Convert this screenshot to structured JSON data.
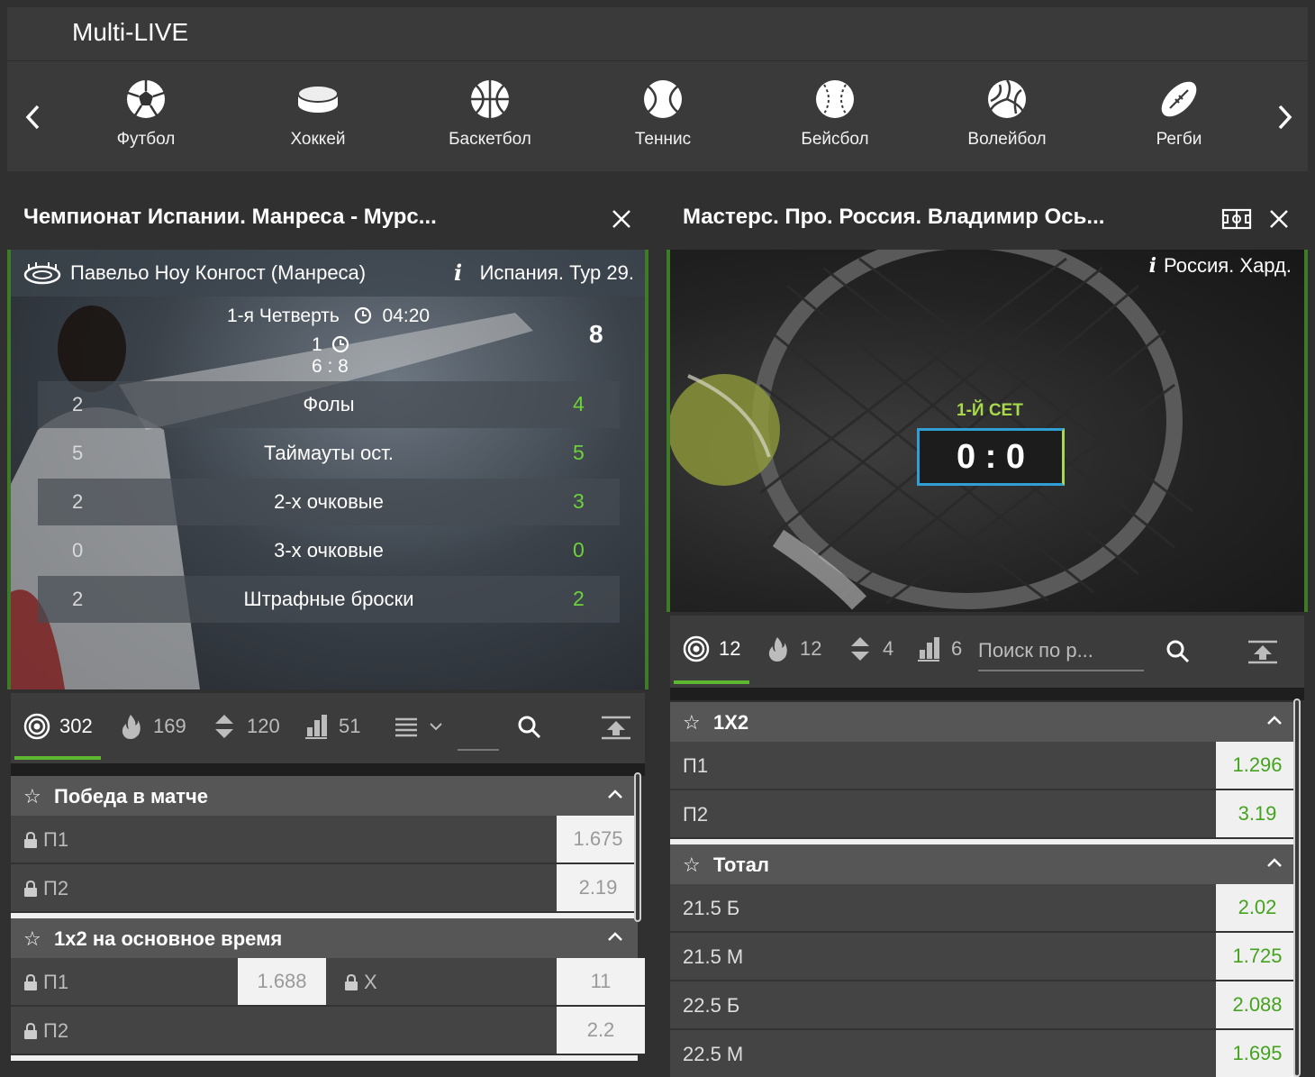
{
  "header": {
    "title": "Multi-LIVE"
  },
  "sports": [
    {
      "label": "Футбол",
      "icon": "soccer-ball-icon"
    },
    {
      "label": "Хоккей",
      "icon": "hockey-puck-icon"
    },
    {
      "label": "Баскетбол",
      "icon": "basketball-icon"
    },
    {
      "label": "Теннис",
      "icon": "tennis-ball-icon"
    },
    {
      "label": "Бейсбол",
      "icon": "baseball-icon"
    },
    {
      "label": "Волейбол",
      "icon": "volleyball-icon"
    },
    {
      "label": "Регби",
      "icon": "rugby-ball-icon"
    }
  ],
  "left_panel": {
    "title": "Чемпионат Испании. Манреса - Мурс...",
    "venue": "Павельо Ноу Конгост (Манреса)",
    "league": "Испания. Тур 29.",
    "period": "1-я Четверть",
    "time": "04:20",
    "timeouts_line": "1",
    "score": "6 : 8",
    "side_value": "8",
    "stats": [
      {
        "a": "2",
        "label": "Фолы",
        "b": "4"
      },
      {
        "a": "5",
        "label": "Таймауты ост.",
        "b": "5"
      },
      {
        "a": "2",
        "label": "2-х очковые",
        "b": "3"
      },
      {
        "a": "0",
        "label": "3-х очковые",
        "b": "0"
      },
      {
        "a": "2",
        "label": "Штрафные броски",
        "b": "2"
      }
    ],
    "tabs": {
      "all": "302",
      "hot": "169",
      "totals": "120",
      "stats": "51"
    },
    "markets": [
      {
        "title": "Победа в матче",
        "rows": [
          {
            "name": "П1",
            "odd": "1.675"
          },
          {
            "name": "П2",
            "odd": "2.19"
          }
        ]
      },
      {
        "title": "1x2 на основное время",
        "row1": {
          "n1": "П1",
          "o1": "1.688",
          "n2": "X",
          "o2": "11"
        },
        "row2": {
          "name": "П2",
          "odd": "2.2"
        }
      }
    ]
  },
  "right_panel": {
    "title": "Мастерс. Про. Россия. Владимир Ось...",
    "location": "Россия. Хард.",
    "set_label": "1-Й СЕТ",
    "score": "0 : 0",
    "tabs": {
      "all": "12",
      "hot": "12",
      "totals": "4",
      "stats": "6"
    },
    "search_placeholder": "Поиск по р...",
    "markets": [
      {
        "title": "1X2",
        "rows": [
          {
            "name": "П1",
            "odd": "1.296"
          },
          {
            "name": "П2",
            "odd": "3.19"
          }
        ]
      },
      {
        "title": "Тотал",
        "rows": [
          {
            "name": "21.5 Б",
            "odd": "2.02"
          },
          {
            "name": "21.5 М",
            "odd": "1.725"
          },
          {
            "name": "22.5 Б",
            "odd": "2.088"
          },
          {
            "name": "22.5 М",
            "odd": "1.695"
          }
        ]
      }
    ]
  },
  "colors": {
    "accent_green": "#5db82f",
    "odd_green": "#45a31f",
    "panel_bg": "#303030"
  }
}
